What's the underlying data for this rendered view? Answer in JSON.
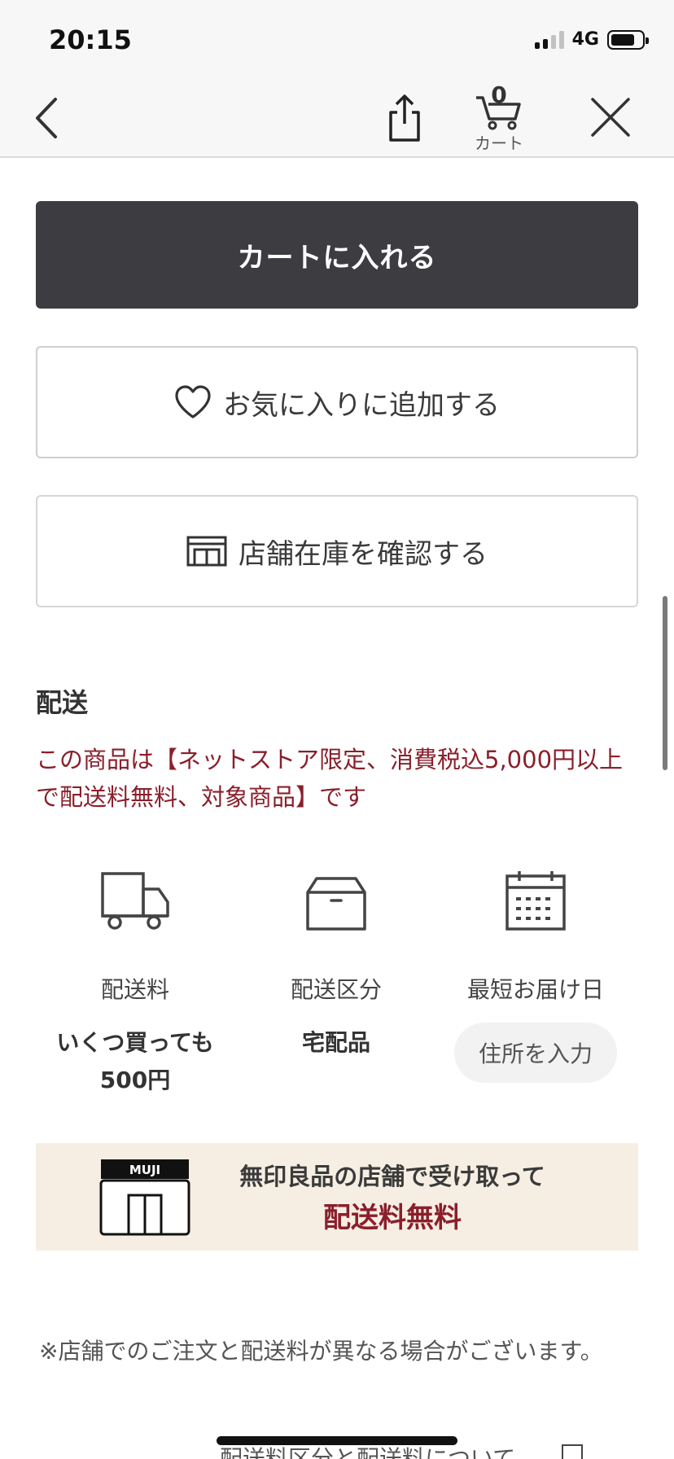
{
  "status_bar": {
    "time": "20:15",
    "network": "4G"
  },
  "nav_bar": {
    "cart_count": "0",
    "cart_label": "カート",
    "icons": [
      "back-chevron-icon",
      "share-icon",
      "cart-icon",
      "close-icon"
    ]
  },
  "actions": {
    "add_to_cart": "カートに入れる",
    "add_favorite": "お気に入りに追加する",
    "check_store_stock": "店舗在庫を確認する"
  },
  "delivery": {
    "title": "配送",
    "note": "この商品は【ネットストア限定、消費税込5,000円以上で配送料無料、対象商品】です",
    "items": [
      {
        "icon": "truck-icon",
        "label": "配送料",
        "value_line1": "いくつ買っても",
        "value_line2": "500円"
      },
      {
        "icon": "box-icon",
        "label": "配送区分",
        "value": "宅配品"
      },
      {
        "icon": "calendar-icon",
        "label": "最短お届け日",
        "button": "住所を入力"
      }
    ]
  },
  "banner": {
    "logo_text": "MUJI",
    "line1": "無印良品の店舗で受け取って",
    "line2": "配送料無料"
  },
  "footnote": "※店舗でのご注文と配送料が異なる場合がございます。",
  "footer_link": "配送料区分と配送料について",
  "colors": {
    "primary_button": "#3c3c41",
    "accent_red": "#8a1f2b",
    "banner_bg": "#f6eee3"
  }
}
